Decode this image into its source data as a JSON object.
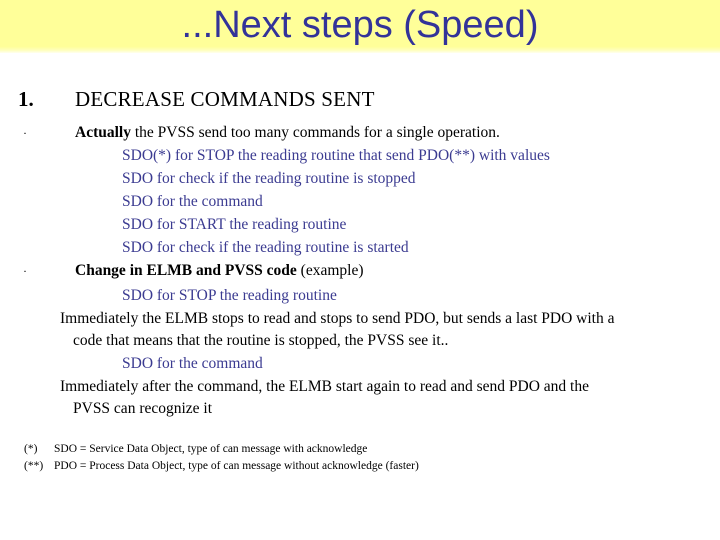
{
  "slide": {
    "title": "...Next steps (Speed)",
    "title_color": "#333399",
    "band_color": "#ffff99",
    "accent_blue": "#3b3b91",
    "background": "#ffffff"
  },
  "section": {
    "number": "1.",
    "heading": "DECREASE COMMANDS SENT"
  },
  "bullets": [
    {
      "marker": "·",
      "bold_lead": "Actually",
      "rest": " the PVSS send too many commands for a single operation.",
      "sub_lines": [
        "SDO(*) for STOP the reading routine that send PDO(**) with values",
        "SDO for check if the reading routine is stopped",
        "SDO for the command",
        "SDO for START the reading routine",
        "SDO for check if the reading routine is started"
      ]
    },
    {
      "marker": "·",
      "bold_lead": "Change in ELMB and PVSS code",
      "rest": " (example)",
      "sub_lines": [
        "SDO for STOP the reading routine",
        "SDO for the command"
      ],
      "paragraphs": [
        {
          "line1": "Immediately the ELMB stops to read and stops to send PDO, but sends a last PDO with a",
          "line2": "code that means that the routine is stopped, the PVSS see it.."
        },
        {
          "line1": "Immediately after the command, the ELMB start again to read and send PDO and the",
          "line2": "PVSS can recognize it"
        }
      ]
    }
  ],
  "footnotes": [
    {
      "marker": "(*)",
      "text": "SDO = Service Data Object, type of can message with acknowledge"
    },
    {
      "marker": "(**)",
      "text": "PDO = Process Data Object, type of can message without acknowledge (faster)"
    }
  ]
}
